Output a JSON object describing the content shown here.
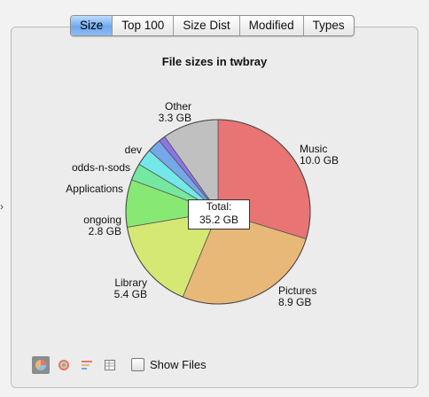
{
  "tabs": [
    {
      "label": "Size",
      "active": true
    },
    {
      "label": "Top 100",
      "active": false
    },
    {
      "label": "Size Dist",
      "active": false
    },
    {
      "label": "Modified",
      "active": false
    },
    {
      "label": "Types",
      "active": false
    }
  ],
  "chart_data": {
    "type": "pie",
    "title": "File sizes in twbray",
    "total_label": "Total:",
    "total_value": "35.2 GB",
    "slices": [
      {
        "name": "Music",
        "size": "10.0 GB",
        "value": 10.0,
        "color": "#e87474"
      },
      {
        "name": "Pictures",
        "size": "8.9 GB",
        "value": 8.9,
        "color": "#e8b878"
      },
      {
        "name": "Library",
        "size": "5.4 GB",
        "value": 5.4,
        "color": "#d6e874"
      },
      {
        "name": "ongoing",
        "size": "2.8 GB",
        "value": 2.8,
        "color": "#88e874"
      },
      {
        "name": "Applications",
        "size": "",
        "value": 1.0,
        "color": "#74e8a0"
      },
      {
        "name": "odds-n-sods",
        "size": "",
        "value": 1.0,
        "color": "#74e8e8"
      },
      {
        "name": "dev",
        "size": "",
        "value": 0.8,
        "color": "#74a8e8"
      },
      {
        "name": "(unlabeled)",
        "size": "",
        "value": 0.4,
        "color": "#8c74e8"
      },
      {
        "name": "Other",
        "size": "3.3 GB",
        "value": 3.3,
        "color": "#c0c0c0"
      }
    ]
  },
  "footer": {
    "icons": [
      "pie-chart-icon",
      "ring-chart-icon",
      "bar-chart-icon",
      "table-icon"
    ],
    "show_files_label": "Show Files",
    "show_files_checked": false
  }
}
